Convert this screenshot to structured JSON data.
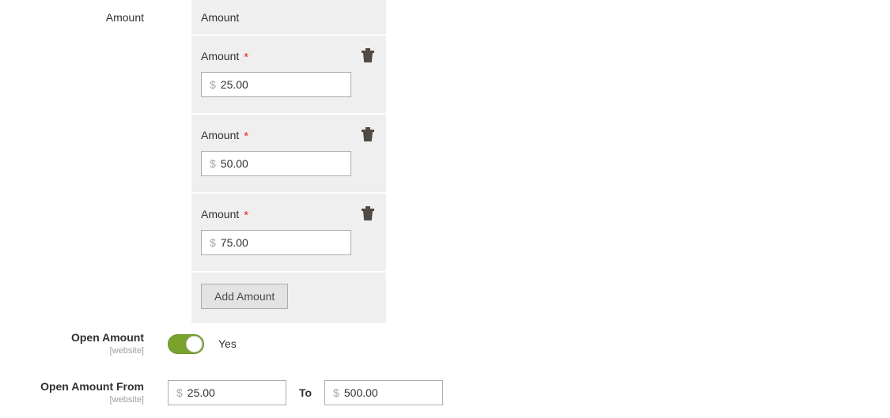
{
  "amount_field": {
    "label": "Amount",
    "panel": {
      "header": "Amount",
      "records": [
        {
          "label": "Amount",
          "required_marker": "*",
          "currency_symbol": "$",
          "value": "25.00",
          "delete_icon": "trash-icon"
        },
        {
          "label": "Amount",
          "required_marker": "*",
          "currency_symbol": "$",
          "value": "50.00",
          "delete_icon": "trash-icon"
        },
        {
          "label": "Amount",
          "required_marker": "*",
          "currency_symbol": "$",
          "value": "75.00",
          "delete_icon": "trash-icon"
        }
      ],
      "add_button": "Add Amount"
    }
  },
  "open_amount": {
    "label": "Open Amount",
    "scope": "[website]",
    "toggle_state": "Yes",
    "toggle_on": true
  },
  "open_amount_range": {
    "label": "Open Amount From",
    "scope": "[website]",
    "from": {
      "currency_symbol": "$",
      "value": "25.00"
    },
    "separator": "To",
    "to": {
      "currency_symbol": "$",
      "value": "500.00"
    }
  },
  "colors": {
    "panel_background": "#efefef",
    "required_star": "#e22626",
    "toggle_on": "#79a22e",
    "input_border": "#adadad",
    "text": "#303030",
    "scope_text": "#9e9e9e",
    "currency_symbol": "#a6a6a6"
  }
}
